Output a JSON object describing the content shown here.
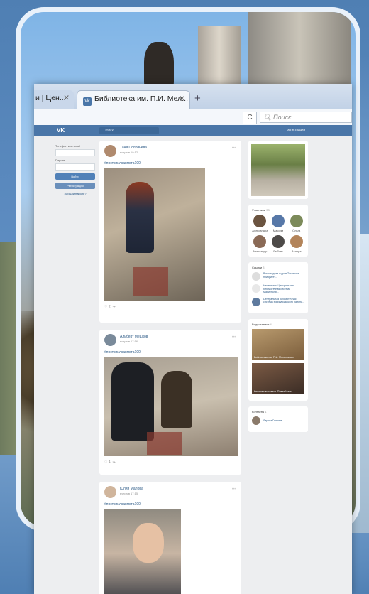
{
  "browser": {
    "tabs": [
      {
        "label": "и | Цен...",
        "active": false
      },
      {
        "label": "Библиотека им. П.И. Мел...",
        "active": true
      }
    ],
    "new_tab": "+",
    "reload": "C",
    "search_placeholder": "Поиск"
  },
  "vk": {
    "logo": "VK",
    "search_placeholder": "Поиск",
    "header_right": "регистрация",
    "login": {
      "email_label": "Телефон или email",
      "password_label": "Пароль",
      "login_button": "Войти",
      "register_button": "Регистрация",
      "forgot_link": "Забыли пароль?"
    },
    "posts": [
      {
        "author": "Таня Соловьева",
        "date": "вчера в 19:12",
        "tag": "#постспилкахмета100",
        "likes": "2"
      },
      {
        "author": "Альберт Мешков",
        "date": "вчера в 17:56",
        "tag": "#постспилкахмета100",
        "likes": "4"
      },
      {
        "author": "Юлия Малова",
        "date": "вчера в 17:15",
        "tag": "#постспилкахмета100",
        "likes": ""
      }
    ],
    "members": {
      "title": "Участники",
      "count": "33",
      "people": [
        "Александра",
        "Максим",
        "Ольга",
        "Александр",
        "Любовь",
        "Валера"
      ]
    },
    "links": {
      "title": "Ссылки",
      "count": "3",
      "items": [
        "В последние годы в Таганроге приоритет...",
        "Неизвестно Центральная библиотечная система Мариуполя...",
        "Центральная библиотечная система Мариупольского района..."
      ]
    },
    "videos": {
      "title": "Видеозаписи",
      "count": "4",
      "items": [
        "Библиотека им. П.И. Мельникова",
        "Книжная выставка. Павел Мель..."
      ]
    },
    "contacts": {
      "title": "Контакты",
      "count": "1",
      "person": "Лариса Галкина"
    }
  }
}
